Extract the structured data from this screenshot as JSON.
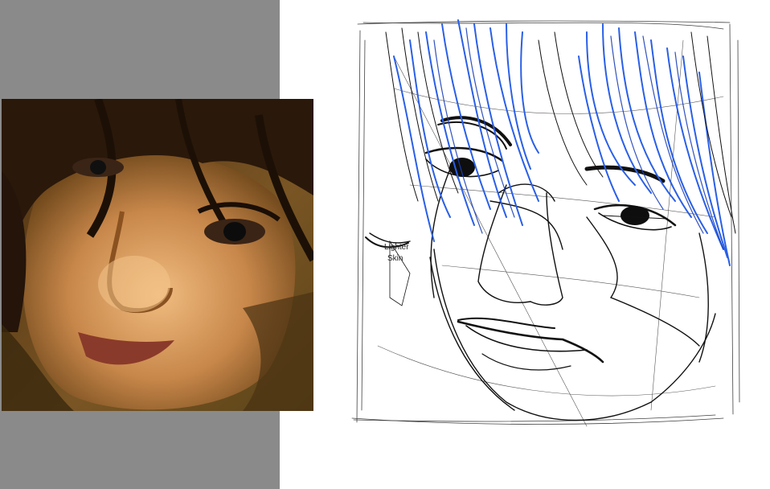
{
  "reference": {
    "image": "reference-portrait-photo",
    "tones": {
      "background_dark": "#3a2410",
      "skin_mid": "#c8874a",
      "skin_light": "#e9b377",
      "hair": "#2a180a",
      "lips": "#8a3a2a"
    }
  },
  "sketch": {
    "image": "line-drawing-sketch",
    "line_color": "#111111",
    "hair_color": "#2a5fe6",
    "note": {
      "line1": "Lighter",
      "line2": "Skin"
    }
  },
  "panel": {
    "color": "#8a8a8a"
  }
}
